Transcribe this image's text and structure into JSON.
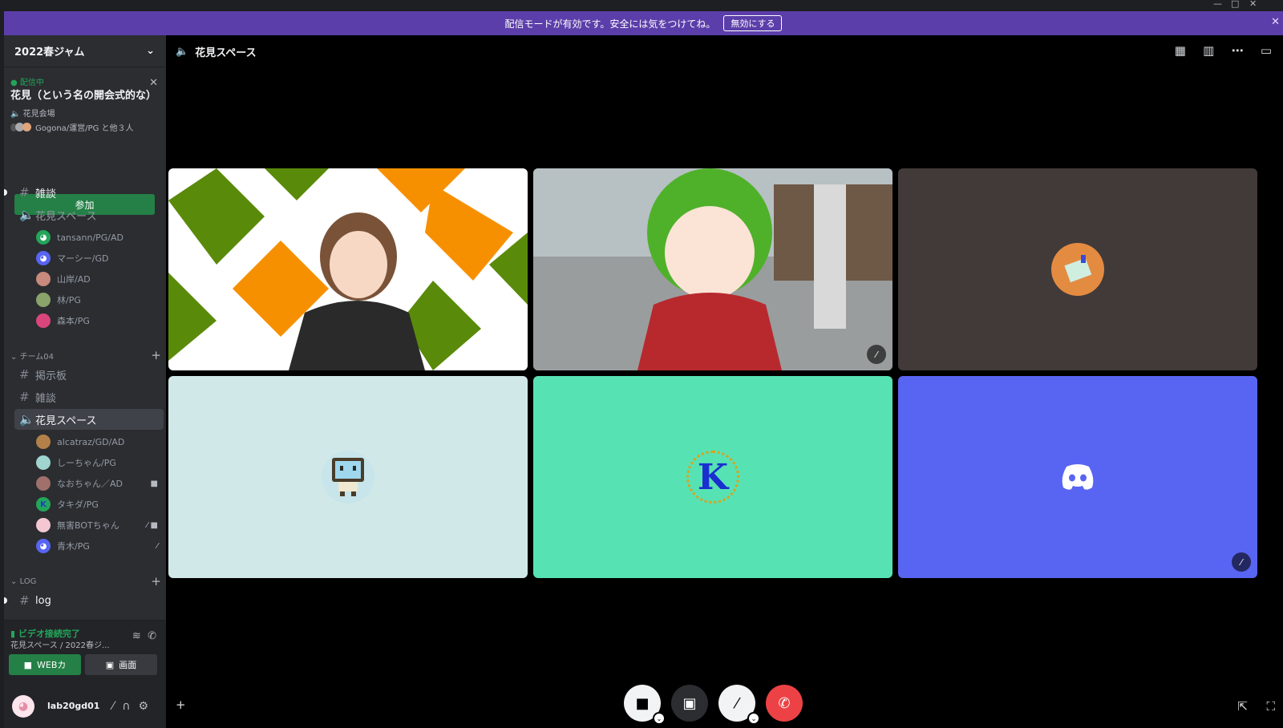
{
  "banner": {
    "text": "配信モードが有効です。安全には気をつけてね。",
    "button": "無効にする"
  },
  "server": {
    "name": "2022春ジャム"
  },
  "live": {
    "status": "● 配信中",
    "title": "花見（という名の開会式的な）",
    "channel": "花見会場",
    "participants": "Gogona/運営/PG と他３人",
    "join": "参加"
  },
  "channels": {
    "zatsudan1": "雑談",
    "hanami1": "花見スペース",
    "users1": [
      {
        "name": "tansann/PG/AD",
        "color": "#23a55a"
      },
      {
        "name": "マーシー/GD",
        "color": "#5865f2"
      },
      {
        "name": "山岸/AD",
        "color": "#c78a7c"
      },
      {
        "name": "林/PG",
        "color": "#8aa36a"
      },
      {
        "name": "森本/PG",
        "color": "#d9457c"
      }
    ],
    "cat_team": "チーム04",
    "keijiban": "掲示板",
    "zatsudan2": "雑談",
    "hanami2": "花見スペース",
    "users2": [
      {
        "name": "alcatraz/GD/AD",
        "color": "#b3804a"
      },
      {
        "name": "しーちゃん/PG",
        "color": "#9fd4cf"
      },
      {
        "name": "なおちゃん／AD",
        "color": "#a0706a"
      },
      {
        "name": "タキダ/PG",
        "color": "#23a55a"
      },
      {
        "name": "無害BOTちゃん",
        "color": "#f4c7d3"
      },
      {
        "name": "青木/PG",
        "color": "#5865f2"
      }
    ],
    "cat_log": "LOG",
    "log": "log"
  },
  "voice": {
    "status": "ビデオ接続完了",
    "location": "花見スペース / 2022春ジ...",
    "camera_btn": "WEBカ",
    "screen_btn": "画面"
  },
  "user": {
    "name": "lab20gd01"
  },
  "main": {
    "title": "花見スペース"
  },
  "colors": {
    "banner": "#5c3eaa",
    "green": "#23a55a",
    "blurple": "#5865f2",
    "teal_tile": "#57e2b3",
    "light_tile": "#d1e8e8",
    "red": "#ed4245"
  },
  "icons": {
    "speaker": "🔈",
    "hash": "#",
    "mute": "🎙"
  }
}
